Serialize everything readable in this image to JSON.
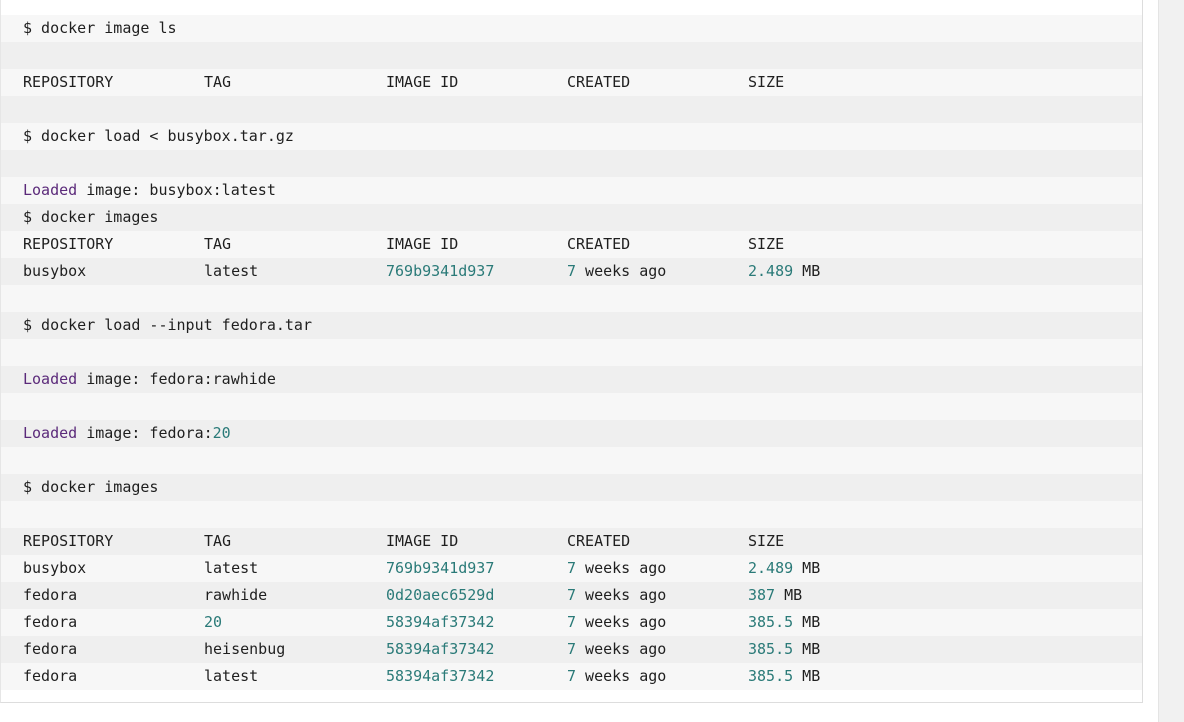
{
  "lines": [
    {
      "kind": "cmd",
      "text": "$ docker image ls"
    },
    {
      "kind": "blank"
    },
    {
      "kind": "header",
      "cols": [
        "REPOSITORY",
        "TAG",
        "IMAGE ID",
        "CREATED",
        "SIZE"
      ]
    },
    {
      "kind": "blank"
    },
    {
      "kind": "cmd",
      "text": "$ docker load < busybox.tar.gz"
    },
    {
      "kind": "blank"
    },
    {
      "kind": "loaded",
      "prefix": "Loaded",
      "rest": " image: busybox:latest"
    },
    {
      "kind": "cmd",
      "text": "$ docker images"
    },
    {
      "kind": "header",
      "cols": [
        "REPOSITORY",
        "TAG",
        "IMAGE ID",
        "CREATED",
        "SIZE"
      ]
    },
    {
      "kind": "row",
      "repo": "busybox",
      "tag": "latest",
      "id": "769b9341d937",
      "created_num": "7",
      "created_rest": " weeks ago",
      "size_num": "2.489",
      "size_unit": " MB"
    },
    {
      "kind": "blank"
    },
    {
      "kind": "cmd",
      "text": "$ docker load --input fedora.tar"
    },
    {
      "kind": "blank"
    },
    {
      "kind": "loaded",
      "prefix": "Loaded",
      "rest": " image: fedora:rawhide"
    },
    {
      "kind": "blank"
    },
    {
      "kind": "loaded",
      "prefix": "Loaded",
      "rest": " image: fedora:",
      "rest_num": "20"
    },
    {
      "kind": "blank"
    },
    {
      "kind": "cmd",
      "text": "$ docker images"
    },
    {
      "kind": "blank"
    },
    {
      "kind": "header",
      "cols": [
        "REPOSITORY",
        "TAG",
        "IMAGE ID",
        "CREATED",
        "SIZE"
      ]
    },
    {
      "kind": "row",
      "repo": "busybox",
      "tag": "latest",
      "id": "769b9341d937",
      "created_num": "7",
      "created_rest": " weeks ago",
      "size_num": "2.489",
      "size_unit": " MB"
    },
    {
      "kind": "row",
      "repo": "fedora",
      "tag": "rawhide",
      "id": "0d20aec6529d",
      "created_num": "7",
      "created_rest": " weeks ago",
      "size_num": "387",
      "size_unit": " MB"
    },
    {
      "kind": "row",
      "repo": "fedora",
      "tag": "20",
      "tag_is_num": true,
      "id": "58394af37342",
      "created_num": "7",
      "created_rest": " weeks ago",
      "size_num": "385.5",
      "size_unit": " MB"
    },
    {
      "kind": "row",
      "repo": "fedora",
      "tag": "heisenbug",
      "id": "58394af37342",
      "created_num": "7",
      "created_rest": " weeks ago",
      "size_num": "385.5",
      "size_unit": " MB"
    },
    {
      "kind": "row",
      "repo": "fedora",
      "tag": "latest",
      "id": "58394af37342",
      "created_num": "7",
      "created_rest": " weeks ago",
      "size_num": "385.5",
      "size_unit": " MB"
    }
  ],
  "colors": {
    "keyword": "#5b2a7a",
    "number": "#2a7a78"
  }
}
